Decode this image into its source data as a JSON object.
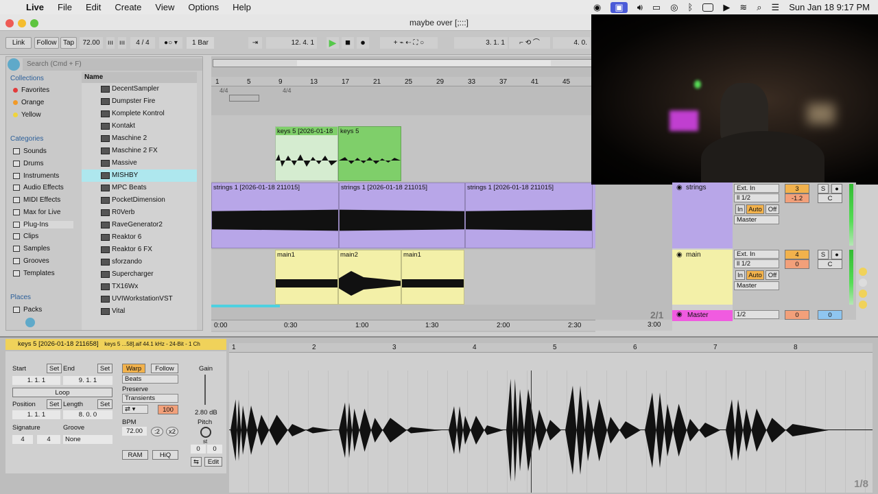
{
  "menubar": {
    "app": "Live",
    "items": [
      "File",
      "Edit",
      "Create",
      "View",
      "Options",
      "Help"
    ],
    "clock": "Sun Jan 18  9:17 PM"
  },
  "window": {
    "title": "maybe over  [;:::]"
  },
  "control_bar": {
    "link": "Link",
    "follow": "Follow",
    "tap": "Tap",
    "tempo": "72.00",
    "signature": "4 / 4",
    "quant": "1 Bar",
    "position": "12.   4.   1",
    "loop_start": "3.   1.   1",
    "loop_end": "4.   0."
  },
  "browser": {
    "search_placeholder": "Search (Cmd + F)",
    "collections_header": "Collections",
    "collections": [
      {
        "label": "Favorites",
        "color": "#e23b3b"
      },
      {
        "label": "Orange",
        "color": "#f29a28"
      },
      {
        "label": "Yellow",
        "color": "#efd43c"
      }
    ],
    "categories_header": "Categories",
    "categories": [
      "Sounds",
      "Drums",
      "Instruments",
      "Audio Effects",
      "MIDI Effects",
      "Max for Live",
      "Plug-Ins",
      "Clips",
      "Samples",
      "Grooves",
      "Templates"
    ],
    "places_header": "Places",
    "places": [
      "Packs"
    ],
    "name_header": "Name",
    "plugins": [
      "DecentSampler",
      "Dumpster Fire",
      "Komplete Kontrol",
      "Kontakt",
      "Maschine 2",
      "Maschine 2 FX",
      "Massive",
      "MISHBY",
      "MPC Beats",
      "PocketDimension",
      "R0Verb",
      "RaveGenerator2",
      "Reaktor 6",
      "Reaktor 6 FX",
      "sforzando",
      "Supercharger",
      "TX16Wx",
      "UVIWorkstationVST",
      "Vital"
    ],
    "selected_plugin": "MISHBY"
  },
  "arrangement": {
    "bar_ruler": [
      "1",
      "5",
      "9",
      "13",
      "17",
      "21",
      "25",
      "29",
      "33",
      "37",
      "41",
      "45"
    ],
    "time_ruler": [
      "0:00",
      "0:30",
      "1:00",
      "1:30",
      "2:00",
      "2:30",
      "3:00"
    ],
    "sig_marks": [
      "4/4",
      "4/4"
    ],
    "page": "2/1",
    "clips": {
      "keys_a": "keys 5 [2026-01-18",
      "keys_b": "keys 5",
      "strings_a": "strings 1 [2026-01-18 211015]",
      "strings_b": "strings 1 [2026-01-18 211015]",
      "strings_c": "strings 1 [2026-01-18 211015]",
      "main_a": "main1",
      "main_b": "main2",
      "main_c": "main1"
    },
    "colors": {
      "keys": "#7fcf6a",
      "strings": "#b8a6e8",
      "main": "#f3f0a8",
      "master": "#f05be0"
    }
  },
  "tracks": [
    {
      "name": "strings",
      "input": "Ext. In",
      "channel": "ll 1/2",
      "output": "Master",
      "number": "3",
      "solo": "S",
      "volume": "-1.2",
      "pan": "C",
      "monitor_in": "In",
      "monitor_auto": "Auto",
      "monitor_off": "Off"
    },
    {
      "name": "main",
      "input": "Ext. In",
      "channel": "ll 1/2",
      "output": "Master",
      "number": "4",
      "solo": "S",
      "volume": "0",
      "pan": "C",
      "monitor_in": "In",
      "monitor_auto": "Auto",
      "monitor_off": "Off"
    },
    {
      "name": "Master",
      "channel": "1/2",
      "volume": "0",
      "pan": "0"
    }
  ],
  "clip_view": {
    "header": "keys 5 [2026-01-18 211658]",
    "file_info": "keys 5 ...58].aif    44.1 kHz - 24-Bit - 1 Ch",
    "start_label": "Start",
    "start": "1.   1.   1",
    "end_label": "End",
    "end": "9.   1.   1",
    "set": "Set",
    "loop": "Loop",
    "position_label": "Position",
    "position": "1.   1.   1",
    "length_label": "Length",
    "length": "8.   0.   0",
    "signature_label": "Signature",
    "sig_num": "4",
    "sig_den": "4",
    "groove_label": "Groove",
    "groove": "None",
    "warp": "Warp",
    "follow": "Follow",
    "mode": "Beats",
    "preserve_label": "Preserve",
    "preserve": "Transients",
    "amount": "100",
    "bpm_label": "BPM",
    "bpm": "72.00",
    "half": ":2",
    "double": "x2",
    "ram": "RAM",
    "hiq": "HiQ",
    "edit": "Edit",
    "gain_label": "Gain",
    "gain": "2.80 dB",
    "pitch_label": "Pitch",
    "pitch_unit": "st",
    "pitch": "0",
    "detune": "0",
    "ruler": [
      "1",
      "2",
      "3",
      "4",
      "5",
      "6",
      "7",
      "8"
    ],
    "page": "1/8"
  }
}
